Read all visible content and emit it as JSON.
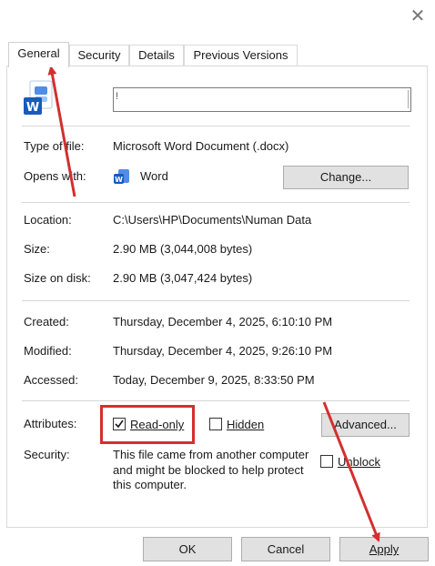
{
  "tabs": [
    {
      "label": "General"
    },
    {
      "label": "Security"
    },
    {
      "label": "Details"
    },
    {
      "label": "Previous Versions"
    }
  ],
  "file_icon": {
    "icon": "word-document-icon",
    "badge": "W"
  },
  "filename": {
    "value": "",
    "caret": "!"
  },
  "type_of_file": {
    "label": "Type of file:",
    "value": "Microsoft Word Document (.docx)"
  },
  "opens_with": {
    "label": "Opens with:",
    "app": "Word",
    "icon": "word-icon",
    "change_button": "Change..."
  },
  "location": {
    "label": "Location:",
    "value": "C:\\Users\\HP\\Documents\\Numan Data"
  },
  "size": {
    "label": "Size:",
    "value": "2.90 MB (3,044,008 bytes)"
  },
  "size_on_disk": {
    "label": "Size on disk:",
    "value": "2.90 MB (3,047,424 bytes)"
  },
  "created": {
    "label": "Created:",
    "value": "Thursday, December 4, 2025, 6:10:10 PM"
  },
  "modified": {
    "label": "Modified:",
    "value": "Thursday, December 4, 2025, 9:26:10 PM"
  },
  "accessed": {
    "label": "Accessed:",
    "value": "Today, December 9, 2025, 8:33:50 PM"
  },
  "attributes": {
    "label": "Attributes:",
    "read_only": {
      "label": "Read-only",
      "checked": true
    },
    "hidden": {
      "label": "Hidden",
      "checked": false
    },
    "advanced_button": "Advanced..."
  },
  "security": {
    "label": "Security:",
    "line1": "This file came from another computer",
    "line2": "and might be blocked to help protect",
    "line3": "this computer.",
    "unblock": {
      "label": "Unblock",
      "checked": false
    }
  },
  "buttons": {
    "ok": "OK",
    "cancel": "Cancel",
    "apply": "Apply"
  },
  "annotation_colors": {
    "arrow": "#d32f2f",
    "highlight": "#d32f2f"
  },
  "accent": {
    "word_blue": "#185abd"
  }
}
